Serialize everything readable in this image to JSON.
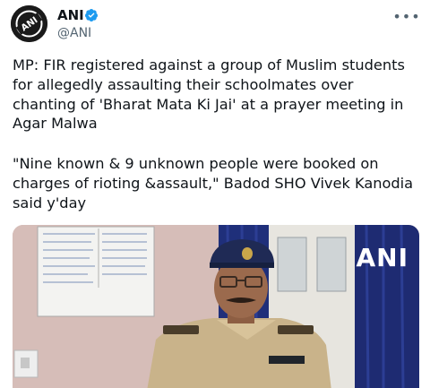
{
  "author": {
    "name": "ANI",
    "handle": "@ANI"
  },
  "tweet": {
    "paragraph1": "MP: FIR registered against a group of Muslim students for allegedly assaulting their schoolmates over chanting of 'Bharat Mata Ki Jai' at a prayer meeting in Agar Malwa",
    "paragraph2": "\"Nine known & 9 unknown people were booked on charges of rioting &assault,\" Badod SHO Vivek Kanodia said y'day"
  },
  "media": {
    "watermark": "ANI"
  },
  "icons": {
    "verified": "verified-badge-icon",
    "more": "more-options-icon"
  },
  "colors": {
    "verified": "#1d9bf0",
    "secondary_text": "#536471",
    "primary_text": "#0f1419"
  }
}
